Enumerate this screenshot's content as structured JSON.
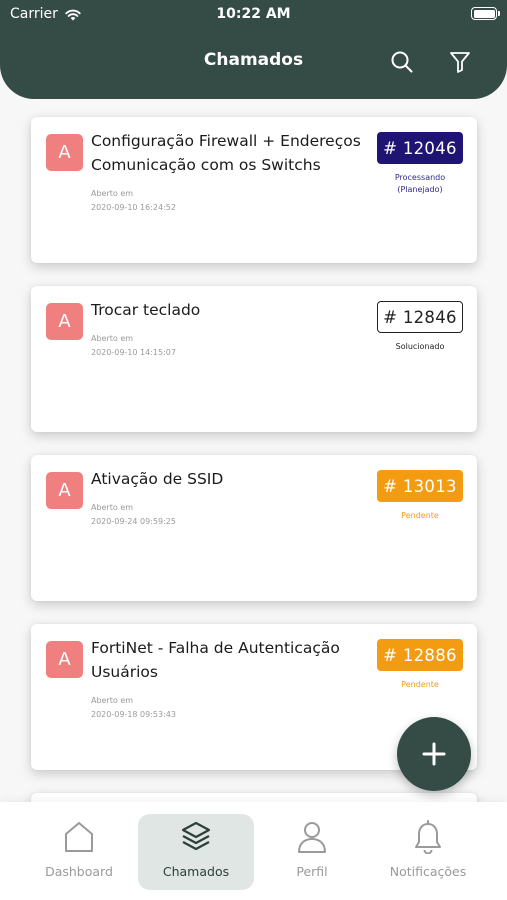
{
  "status_bar": {
    "carrier": "Carrier",
    "time": "10:22 AM"
  },
  "header": {
    "title": "Chamados"
  },
  "tickets": [
    {
      "avatar": "A",
      "title": "Configuração Firewall + Endereços Comunicação com os Switchs",
      "opened_label": "Aberto em",
      "opened_date": "2020-09-10 16:24:52",
      "number": "# 12046",
      "status": "Processando (Planejado)",
      "status_color": "#1f1373"
    },
    {
      "avatar": "A",
      "title": "Trocar teclado",
      "opened_label": "Aberto em",
      "opened_date": "2020-09-10 14:15:07",
      "number": "# 12846",
      "status": "Solucionado",
      "status_color": "#222222"
    },
    {
      "avatar": "A",
      "title": "Ativação de SSID",
      "opened_label": "Aberto em",
      "opened_date": "2020-09-24 09:59:25",
      "number": "# 13013",
      "status": "Pendente",
      "status_color": "#f39c12"
    },
    {
      "avatar": "A",
      "title": "FortiNet - Falha de Autenticação Usuários",
      "opened_label": "Aberto em",
      "opened_date": "2020-09-18 09:53:43",
      "number": "# 12886",
      "status": "Pendente",
      "status_color": "#f39c12"
    }
  ],
  "tabbar": {
    "items": [
      {
        "label": "Dashboard",
        "icon": "home-icon"
      },
      {
        "label": "Chamados",
        "icon": "layers-icon",
        "active": true
      },
      {
        "label": "Perfil",
        "icon": "user-icon"
      },
      {
        "label": "Notificações",
        "icon": "bell-icon"
      }
    ]
  },
  "colors": {
    "primary": "#344c45",
    "avatar": "#f08080",
    "processing": "#1f1373",
    "pending": "#f39c12"
  }
}
